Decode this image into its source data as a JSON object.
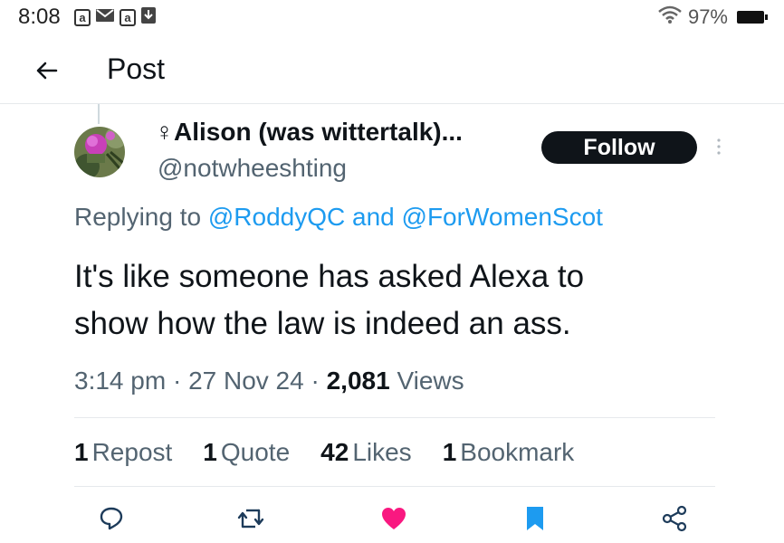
{
  "status_bar": {
    "time": "8:08",
    "icons": [
      "amazon-icon",
      "mail-icon",
      "amazon-icon",
      "download-icon"
    ],
    "battery": "97%"
  },
  "header": {
    "title": "Post"
  },
  "post": {
    "display_name": "♀Alison (was wittertalk)...",
    "handle": "@notwheeshting",
    "follow_label": "Follow",
    "replying_prefix": "Replying to",
    "replying_to": [
      "@RoddyQC",
      "@ForWomenScot"
    ],
    "replying_and": "and",
    "text_line1": "It's like someone has asked Alexa to",
    "text_line2": "show how the law is indeed an ass.",
    "time": "3:14 pm",
    "date": "27 Nov 24",
    "views_count": "2,081",
    "views_label": "Views"
  },
  "stats": {
    "reposts_count": "1",
    "reposts_label": "Repost",
    "quotes_count": "1",
    "quotes_label": "Quote",
    "likes_count": "42",
    "likes_label": "Likes",
    "bookmarks_count": "1",
    "bookmarks_label": "Bookmark"
  },
  "colors": {
    "link": "#1d9bf0",
    "like": "#f91880",
    "bookmark": "#1d9bf0"
  }
}
